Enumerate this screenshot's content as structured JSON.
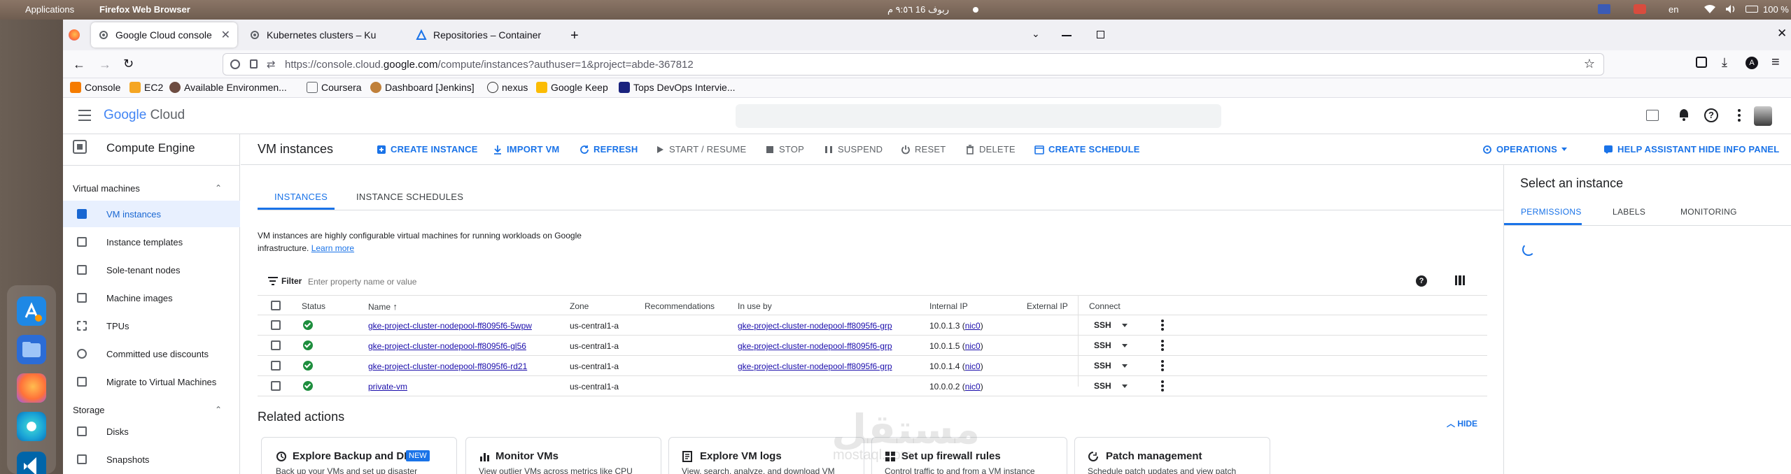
{
  "os_bar": {
    "applications": "Applications",
    "active_app": "Firefox Web Browser",
    "clock": "ربوف 16 ٩:٥٦ م",
    "lang": "en",
    "battery": "100 %"
  },
  "browser": {
    "tabs": [
      {
        "label": "Google Cloud console"
      },
      {
        "label": "Kubernetes clusters – Ku"
      },
      {
        "label": "Repositories – Container"
      }
    ],
    "url_prefix": "https://console.cloud.",
    "url_domain": "google.com",
    "url_suffix": "/compute/instances?authuser=1&project=abde-367812",
    "bookmarks": [
      {
        "label": "Console",
        "color": "#f57c00"
      },
      {
        "label": "EC2",
        "color": "#f5a623"
      },
      {
        "label": "Available Environmen...",
        "color": "#6d4c41"
      },
      {
        "label": "Coursera",
        "color": "#5f6368"
      },
      {
        "label": "Dashboard [Jenkins]",
        "color": "#c0803a"
      },
      {
        "label": "nexus",
        "color": "#333333"
      },
      {
        "label": "Google Keep",
        "color": "#fbbc04"
      },
      {
        "label": "Tops DevOps Intervie...",
        "color": "#1a237e"
      }
    ]
  },
  "gcp": {
    "logo_google": "Google",
    "logo_cloud": "Cloud"
  },
  "sidebar": {
    "product_title": "Compute Engine",
    "sections": [
      {
        "label": "Virtual machines",
        "items": [
          {
            "label": "VM instances"
          },
          {
            "label": "Instance templates"
          },
          {
            "label": "Sole-tenant nodes"
          },
          {
            "label": "Machine images"
          },
          {
            "label": "TPUs"
          },
          {
            "label": "Committed use discounts"
          },
          {
            "label": "Migrate to Virtual Machines"
          }
        ]
      },
      {
        "label": "Storage",
        "items": [
          {
            "label": "Disks"
          },
          {
            "label": "Snapshots"
          }
        ]
      }
    ]
  },
  "toolbar": {
    "page_title": "VM instances",
    "create": "CREATE INSTANCE",
    "import": "IMPORT VM",
    "refresh": "REFRESH",
    "start": "START / RESUME",
    "stop": "STOP",
    "suspend": "SUSPEND",
    "reset": "RESET",
    "delete": "DELETE",
    "schedule": "CREATE SCHEDULE",
    "operations": "OPERATIONS",
    "help": "HELP ASSISTANT",
    "hide_info": "HIDE INFO PANEL"
  },
  "main": {
    "tabs": [
      {
        "label": "INSTANCES"
      },
      {
        "label": "INSTANCE SCHEDULES"
      }
    ],
    "description_line1": "VM instances are highly configurable virtual machines for running workloads on Google",
    "description_line2": "infrastructure.",
    "learn_more": "Learn more",
    "filter_label": "Filter",
    "filter_placeholder": "Enter property name or value",
    "columns": [
      "Status",
      "Name",
      "Zone",
      "Recommendations",
      "In use by",
      "Internal IP",
      "External IP",
      "Connect"
    ],
    "rows": [
      {
        "name": "gke-project-cluster-nodepool-ff8095f6-5wpw",
        "zone": "us-central1-a",
        "in_use_by": "gke-project-cluster-nodepool-ff8095f6-grp",
        "internal_ip": "10.0.1.3",
        "nic": "nic0",
        "connect": "SSH"
      },
      {
        "name": "gke-project-cluster-nodepool-ff8095f6-gl56",
        "zone": "us-central1-a",
        "in_use_by": "gke-project-cluster-nodepool-ff8095f6-grp",
        "internal_ip": "10.0.1.5",
        "nic": "nic0",
        "connect": "SSH"
      },
      {
        "name": "gke-project-cluster-nodepool-ff8095f6-rd21",
        "zone": "us-central1-a",
        "in_use_by": "gke-project-cluster-nodepool-ff8095f6-grp",
        "internal_ip": "10.0.1.4",
        "nic": "nic0",
        "connect": "SSH"
      },
      {
        "name": "private-vm",
        "zone": "us-central1-a",
        "in_use_by": "",
        "internal_ip": "10.0.0.2",
        "nic": "nic0",
        "connect": "SSH"
      }
    ],
    "related_title": "Related actions",
    "hide": "HIDE",
    "cards": [
      {
        "title": "Explore Backup and DR",
        "badge": "NEW",
        "desc": "Back up your VMs and set up disaster"
      },
      {
        "title": "Monitor VMs",
        "desc": "View outlier VMs across metrics like CPU"
      },
      {
        "title": "Explore VM logs",
        "desc": "View, search, analyze, and download VM"
      },
      {
        "title": "Set up firewall rules",
        "desc": "Control traffic to and from a VM instance"
      },
      {
        "title": "Patch management",
        "desc": "Schedule patch updates and view patch"
      }
    ]
  },
  "info_panel": {
    "title": "Select an instance",
    "tabs": [
      {
        "label": "PERMISSIONS"
      },
      {
        "label": "LABELS"
      },
      {
        "label": "MONITORING"
      }
    ]
  },
  "watermark": {
    "text": "مستقل",
    "sub": "mostaql.com"
  }
}
